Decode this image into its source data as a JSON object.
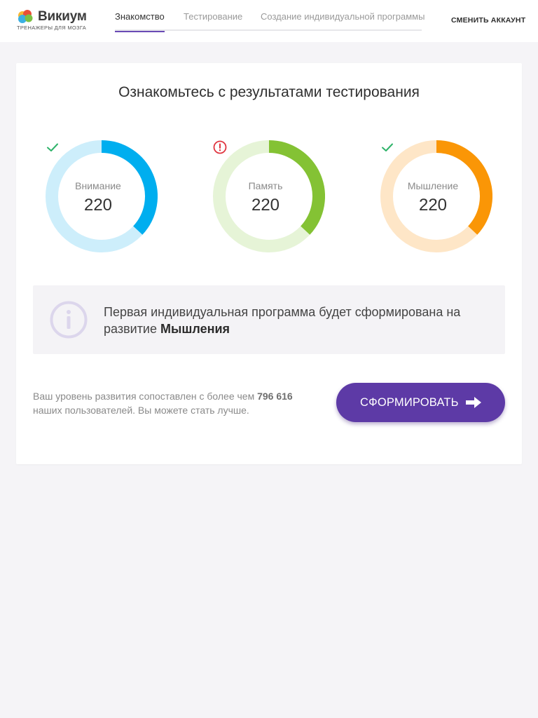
{
  "brand": {
    "name": "Викиум",
    "tagline": "ТРЕНАЖЕРЫ ДЛЯ МОЗГА",
    "colors": [
      "#f7b733",
      "#e94f37",
      "#3ab0e2",
      "#7cc043"
    ]
  },
  "nav": {
    "tabs": [
      {
        "label": "Знакомство",
        "active": true
      },
      {
        "label": "Тестирование",
        "active": false
      },
      {
        "label": "Создание индивидуальной программы",
        "active": false
      }
    ],
    "account_label": "СМЕНИТЬ АККАУНТ"
  },
  "results": {
    "title": "Ознакомьтесь с результатами тестирования",
    "gauges": [
      {
        "label": "Внимание",
        "value": "220",
        "status": "check-icon",
        "fraction": 0.37,
        "color": "#00aeef",
        "track": "#cdeefb"
      },
      {
        "label": "Память",
        "value": "220",
        "status": "warning-icon",
        "fraction": 0.37,
        "color": "#84c234",
        "track": "#e6f4d7"
      },
      {
        "label": "Мышление",
        "value": "220",
        "status": "check-icon",
        "fraction": 0.37,
        "color": "#fa9606",
        "track": "#fee6c7"
      }
    ]
  },
  "info": {
    "icon": "info-icon",
    "text_prefix": "Первая индивидуальная программа будет сформирована на развитие ",
    "text_bold": "Мышления"
  },
  "comparison": {
    "text_prefix": "Ваш уровень развития сопоставлен с более чем ",
    "count": "796 616",
    "text_suffix": " наших пользователей. Вы можете стать лучше."
  },
  "cta": {
    "label": "СФОРМИРОВАТЬ",
    "icon": "arrow-right-icon",
    "color": "#5d3aa6"
  }
}
